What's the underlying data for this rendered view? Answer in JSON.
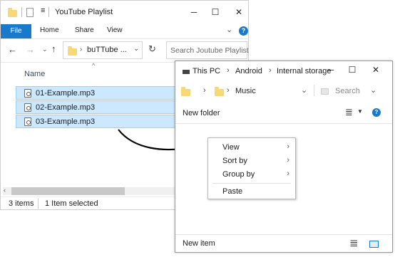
{
  "left_window": {
    "title": "YouTube Playlist",
    "minimize": "─",
    "maximize": "☐",
    "close": "✕",
    "ribbon_tabs": [
      "File",
      "Home",
      "Share",
      "View"
    ],
    "address": "buTTube ...",
    "search_placeholder": "Search Joutube Playlist",
    "column_name": "Name",
    "files": [
      "01-Example.mp3",
      "02-Example.mp3",
      "03-Example.mp3"
    ],
    "status_items": "3 items",
    "status_selected": "1 Item selected"
  },
  "right_window": {
    "breadcrumb": [
      "This PC",
      "Android",
      "Internal storage"
    ],
    "minimize": "─",
    "maximize": "☐",
    "close": "✕",
    "folder": "Music",
    "search_placeholder": "Search",
    "new_folder": "New folder",
    "new_item": "New item"
  },
  "context_menu": {
    "items": [
      "View",
      "Sort by",
      "Group by"
    ],
    "paste": "Paste"
  },
  "colors": {
    "accent": "#1979ca",
    "selection": "#cce8ff",
    "selection_border": "#99d1ff",
    "folder": "#f8d775"
  }
}
